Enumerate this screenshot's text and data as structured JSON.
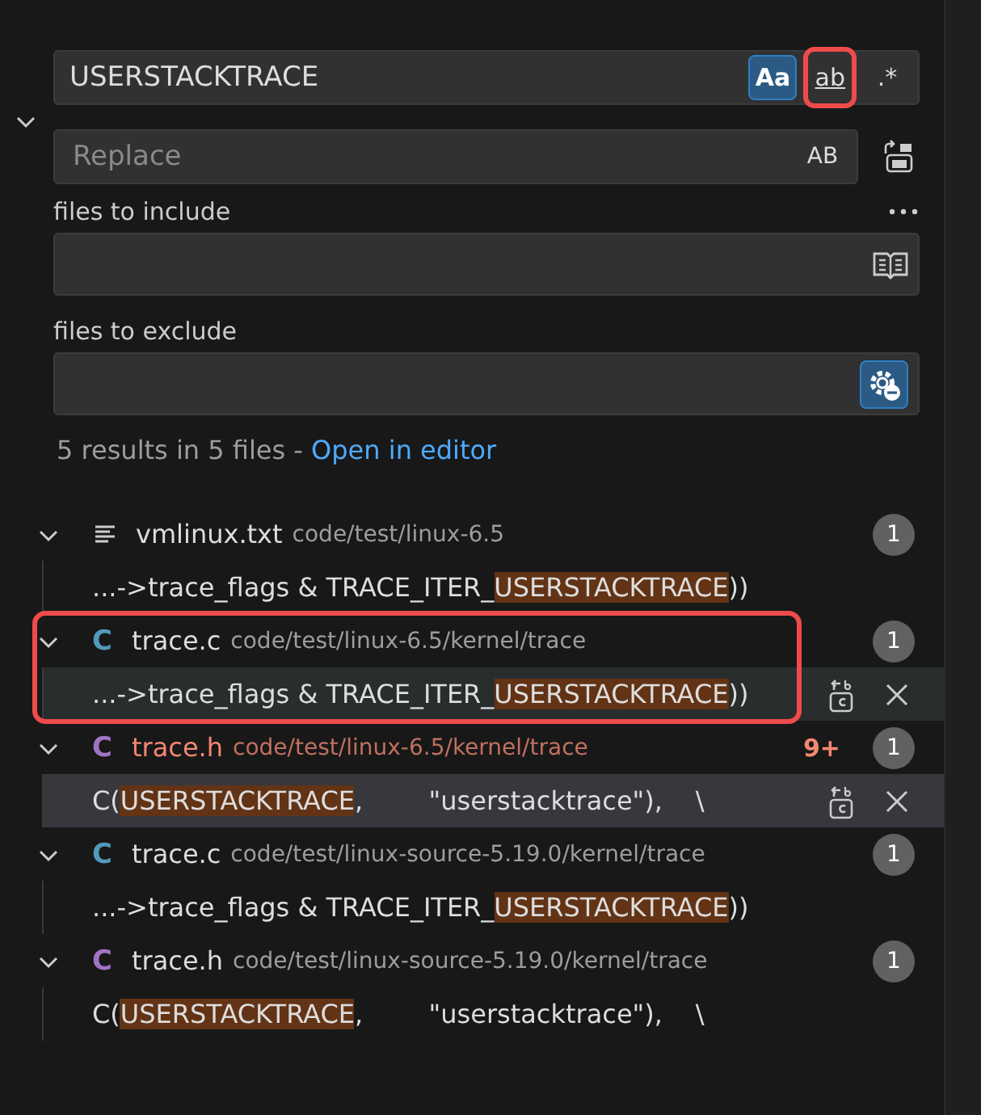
{
  "search": {
    "value": "USERSTACKTRACE",
    "options": [
      {
        "kind": "case",
        "label": "Aa",
        "selected": true,
        "highlighted": false
      },
      {
        "kind": "word",
        "label": "ab",
        "selected": false,
        "highlighted": true
      },
      {
        "kind": "regex",
        "label": ".*",
        "selected": false,
        "highlighted": false
      }
    ]
  },
  "replace": {
    "expanded": true,
    "placeholder": "Replace",
    "preserve_case": "AB"
  },
  "include": {
    "label": "files to include"
  },
  "exclude": {
    "label": "files to exclude",
    "use_exclude_settings": true
  },
  "summary": {
    "text": "5 results in 5 files - ",
    "link": "Open in editor"
  },
  "results": [
    {
      "kind": "text",
      "name": "vmlinux.txt",
      "path": "code/test/linux-6.5",
      "count": "1",
      "error": false,
      "highlighted": false,
      "matches": [
        {
          "before": "...->trace_flags & TRACE_ITER_",
          "match": "USERSTACKTRACE",
          "after": "))",
          "hovered": false,
          "selected": false
        }
      ]
    },
    {
      "kind": "source",
      "icon_letter": "C",
      "name": "trace.c",
      "path": "code/test/linux-6.5/kernel/trace",
      "count": "1",
      "error": false,
      "highlighted": true,
      "matches": [
        {
          "before": "...->trace_flags & TRACE_ITER_",
          "match": "USERSTACKTRACE",
          "after": "))",
          "hovered": true,
          "selected": false
        }
      ]
    },
    {
      "kind": "header",
      "icon_letter": "C",
      "name": "trace.h",
      "path": "code/test/linux-6.5/kernel/trace",
      "count": "1",
      "error": true,
      "problems": "9+",
      "highlighted": false,
      "matches": [
        {
          "before": "C(",
          "match": "USERSTACKTRACE",
          "after": ",        \"userstacktrace\"),    \\",
          "hovered": false,
          "selected": true
        }
      ]
    },
    {
      "kind": "source",
      "icon_letter": "C",
      "name": "trace.c",
      "path": "code/test/linux-source-5.19.0/kernel/trace",
      "count": "1",
      "error": false,
      "highlighted": false,
      "matches": [
        {
          "before": "...->trace_flags & TRACE_ITER_",
          "match": "USERSTACKTRACE",
          "after": "))",
          "hovered": false,
          "selected": false
        }
      ]
    },
    {
      "kind": "header",
      "icon_letter": "C",
      "name": "trace.h",
      "path": "code/test/linux-source-5.19.0/kernel/trace",
      "count": "1",
      "error": false,
      "highlighted": false,
      "matches": [
        {
          "before": "C(",
          "match": "USERSTACKTRACE",
          "after": ",        \"userstacktrace\"),    \\",
          "hovered": false,
          "selected": false
        }
      ]
    }
  ]
}
